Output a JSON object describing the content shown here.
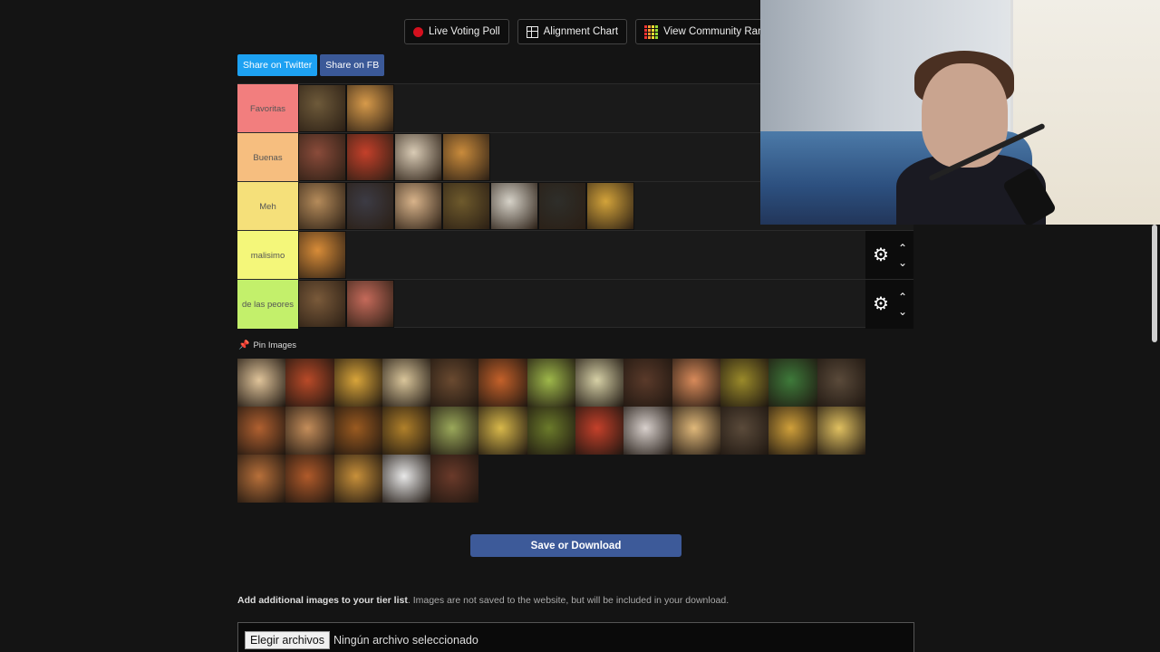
{
  "toolbar": {
    "live_poll_label": "Live Voting Poll",
    "alignment_label": "Alignment Chart",
    "community_label": "View Community Rank"
  },
  "share": {
    "twitter_label": "Share on Twitter",
    "fb_label": "Share on FB"
  },
  "tiers": [
    {
      "label": "Favoritas",
      "color": "#f27e7e",
      "items": [
        "#6e5a3a",
        "#d79a4a"
      ]
    },
    {
      "label": "Buenas",
      "color": "#f6be7f",
      "items": [
        "#8a4b3a",
        "#c4402a",
        "#d9cbb5",
        "#c98b3c"
      ]
    },
    {
      "label": "Meh",
      "color": "#f5e07a",
      "items": [
        "#b58b5a",
        "#3c3b44",
        "#d8b38a",
        "#6e5a2c",
        "#d6d2c8",
        "#2e2e2a",
        "#d3a33a"
      ]
    },
    {
      "label": "malisimo",
      "color": "#f4f77a",
      "items": [
        "#d88c38"
      ]
    },
    {
      "label": "de las peores",
      "color": "#c3f06b",
      "items": [
        "#7a5a3a",
        "#c56a5a"
      ]
    }
  ],
  "pin_label": "Pin Images",
  "pool": [
    "#e0c49a",
    "#b94a28",
    "#d9a53a",
    "#d9c59a",
    "#6a4a30",
    "#c4612a",
    "#9eb84a",
    "#d6d0a6",
    "#5a3a2a",
    "#d88a5a",
    "#9a8a2a",
    "#3e7a3a",
    "#5a4a3a",
    "#b06030",
    "#c48d5a",
    "#9a5a20",
    "#b0802a",
    "#9aa85a",
    "#d8b84a",
    "#6a7a2a",
    "#c4402a",
    "#d8d0cc",
    "#e0b87a",
    "#5a4a3a",
    "#d0a03a",
    "#e0c060",
    "#b8703a",
    "#b05a2a",
    "#c8903a",
    "#e8e8e8",
    "#6a3a2a"
  ],
  "save_label": "Save or Download",
  "add_info": {
    "bold": "Add additional images to your tier list",
    "rest": ". Images are not saved to the website, but will be included in your download."
  },
  "file": {
    "button": "Elegir archivos",
    "status": "Ningún archivo seleccionado"
  },
  "icons": {
    "gear": "gear-icon",
    "up": "chevron-up-icon",
    "down": "chevron-down-icon",
    "pin": "pin-icon"
  }
}
